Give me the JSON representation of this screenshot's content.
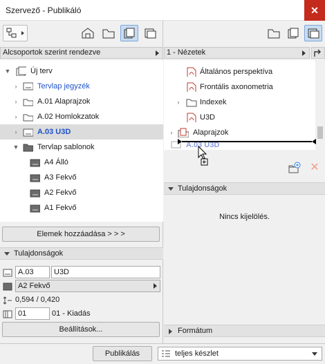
{
  "window": {
    "title": "Szervező - Publikáló",
    "close_glyph": "✕"
  },
  "left": {
    "sort_dropdown": "Alcsoportok szerint rendezve",
    "tree": [
      {
        "label": "Új terv",
        "style": "normal"
      },
      {
        "label": "Tervlap jegyzék",
        "style": "blue"
      },
      {
        "label": "A.01 Alaprajzok",
        "style": "normal"
      },
      {
        "label": "A.02 Homlokzatok",
        "style": "normal"
      },
      {
        "label": "A.03 U3D",
        "style": "bold-blue"
      },
      {
        "label": "Tervlap sablonok",
        "style": "normal"
      },
      {
        "label": "A4 Álló",
        "style": "normal"
      },
      {
        "label": "A3 Fekvő",
        "style": "normal"
      },
      {
        "label": "A2 Fekvő",
        "style": "normal"
      },
      {
        "label": "A1 Fekvő",
        "style": "normal"
      }
    ],
    "add_items_button": "Elemek hozzáadása > > >",
    "properties": {
      "header": "Tulajdonságok",
      "id_value": "A.03",
      "name_value": "U3D",
      "master_value": "A2 Fekvő",
      "size_value": "0,594 / 0,420",
      "revision_value": "01",
      "revision_label": "01 - Kiadás",
      "settings_button": "Beállítások..."
    }
  },
  "right": {
    "set_dropdown": "1 - Nézetek",
    "tree": [
      {
        "label": "Általános perspektíva"
      },
      {
        "label": "Frontális axonometria"
      },
      {
        "label": "Indexek"
      },
      {
        "label": "U3D"
      },
      {
        "label": "Alaprajzok"
      },
      {
        "label": "A.03 U3D"
      }
    ],
    "properties_header": "Tulajdonságok",
    "no_selection": "Nincs kijelölés.",
    "format_header": "Formátum"
  },
  "bottom": {
    "publish_button": "Publikálás",
    "set_selector": "teljes készlet"
  },
  "colors": {
    "accent_blue": "#1e50c8",
    "close_red": "#c42b1c",
    "selection": "#dcdcdc"
  }
}
